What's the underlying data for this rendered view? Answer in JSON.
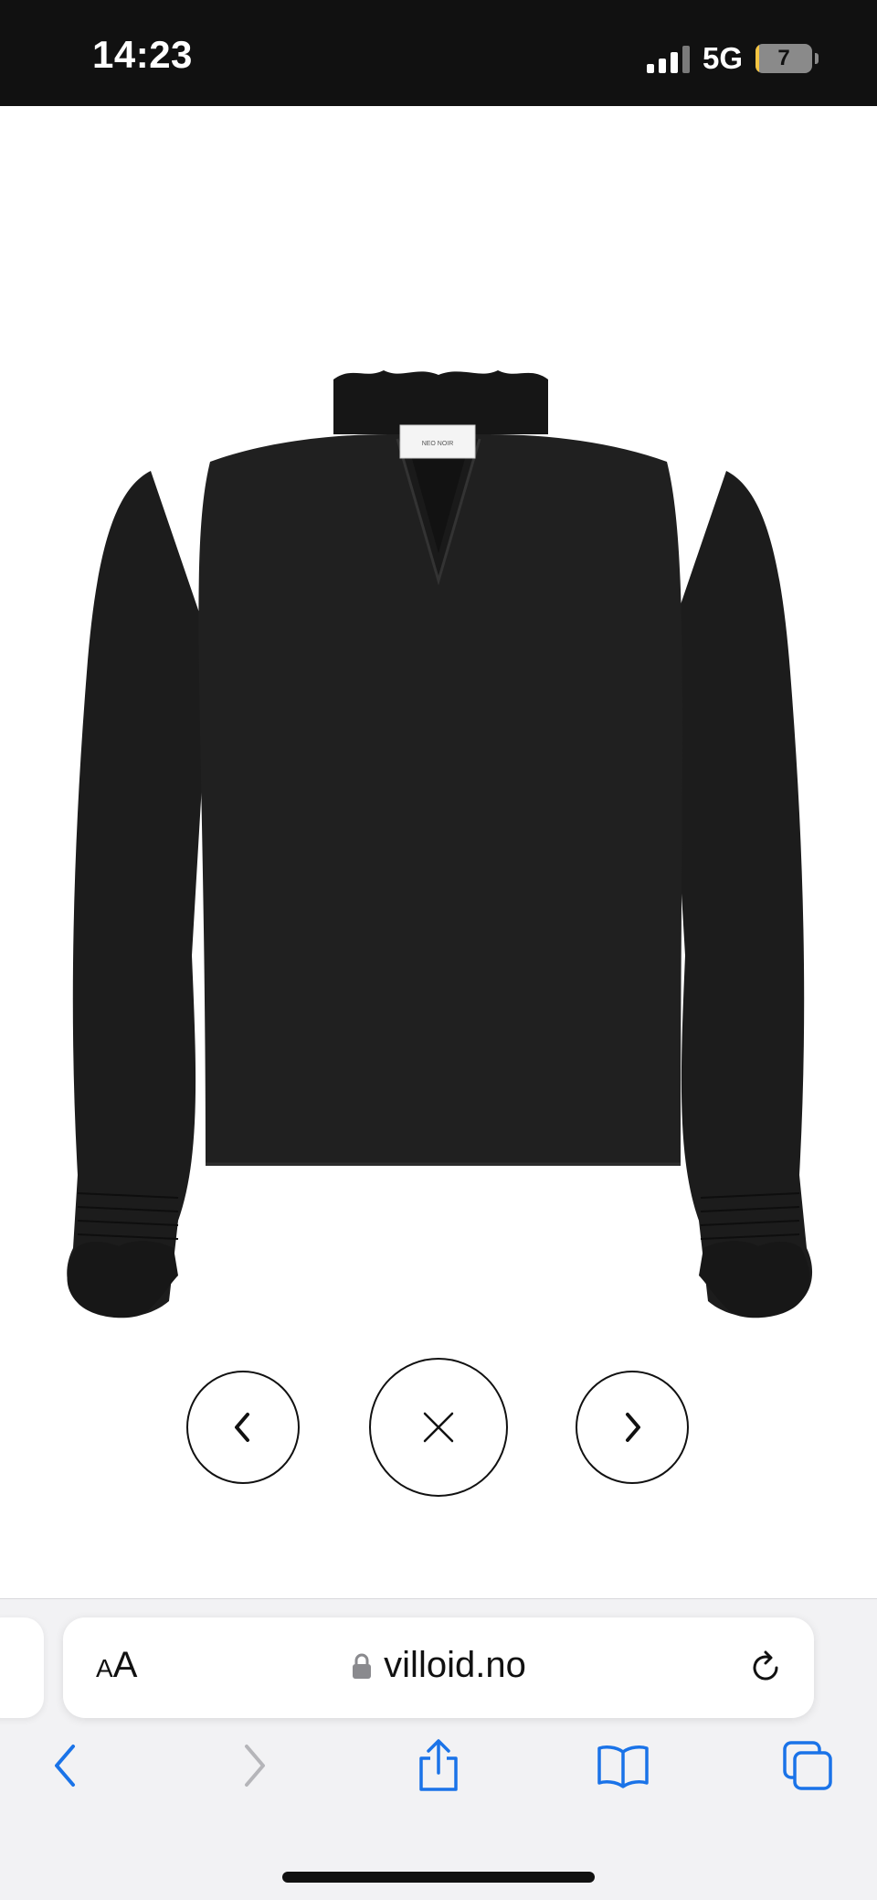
{
  "status_bar": {
    "time": "14:23",
    "network": "5G",
    "battery": "7",
    "battery_fraction": 0.07,
    "signal_icon": "cellular-signal-icon"
  },
  "product": {
    "image_icon": "black-denim-blouse-image",
    "brand_label": "NEO NOIR"
  },
  "gallery_controls": {
    "prev_icon": "chevron-left-icon",
    "close_icon": "close-icon",
    "next_icon": "chevron-right-icon"
  },
  "safari": {
    "reader_small": "A",
    "reader_large": "A",
    "url": "villoid.no",
    "lock_icon": "lock-icon",
    "reload_icon": "reload-icon",
    "toolbar_icons": [
      "back-arrow-icon",
      "forward-arrow-icon",
      "share-icon",
      "bookmarks-icon",
      "tabs-icon"
    ]
  },
  "colors": {
    "status_bar_bg": "#111111",
    "safari_accent": "#1a73e8",
    "disabled_gray": "#b5b5b9",
    "garment": "#1e1e1e"
  }
}
